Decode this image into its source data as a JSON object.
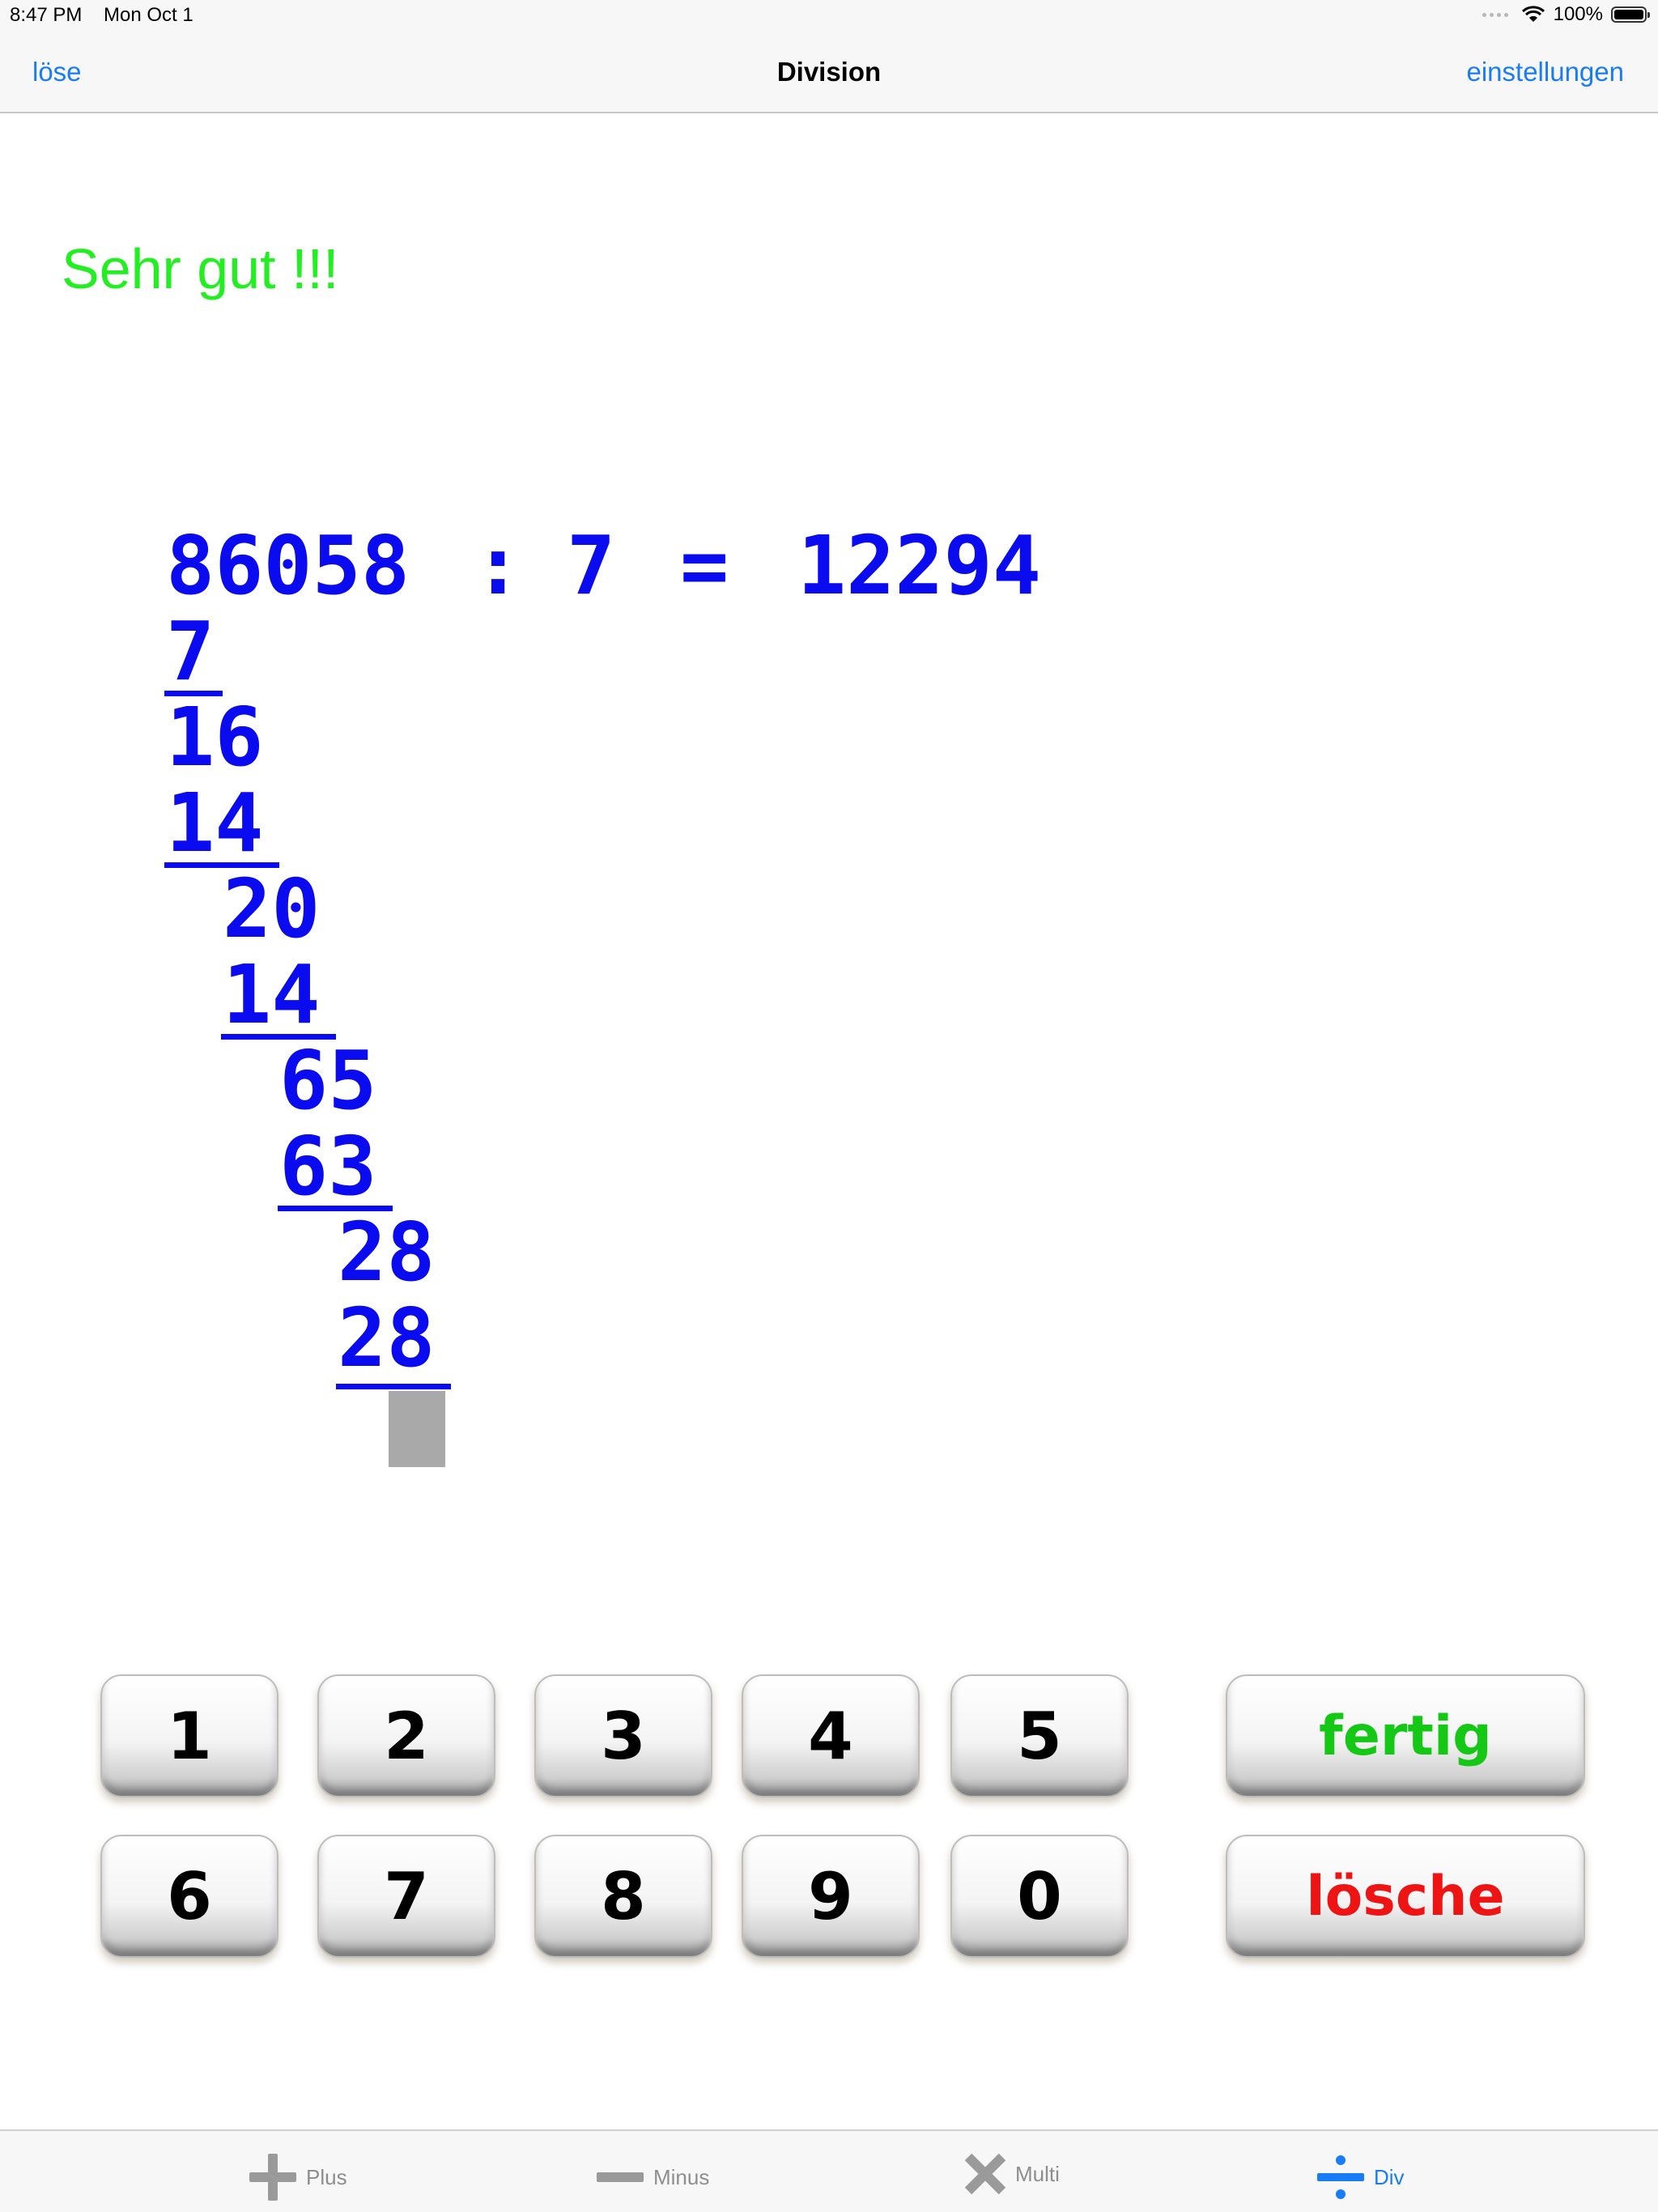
{
  "status_bar": {
    "time": "8:47 PM",
    "date": "Mon Oct 1",
    "battery": "100%"
  },
  "nav": {
    "left_button": "löse",
    "title": "Division",
    "right_button": "einstellungen"
  },
  "feedback": "Sehr gut !!!",
  "problem": {
    "dividend": "86058",
    "operator": ":",
    "divisor": "7",
    "equals": "=",
    "quotient": "12294",
    "steps": [
      "7",
      "16",
      "14",
      "20",
      "14",
      "65",
      "63",
      "28",
      "28"
    ]
  },
  "keypad": {
    "digits": [
      "1",
      "2",
      "3",
      "4",
      "5",
      "6",
      "7",
      "8",
      "9",
      "0"
    ],
    "done_label": "fertig",
    "delete_label": "lösche",
    "done_color": "#16c816",
    "delete_color": "#ee1414"
  },
  "tabs": [
    {
      "label": "Plus",
      "icon": "plus-icon"
    },
    {
      "label": "Minus",
      "icon": "minus-icon"
    },
    {
      "label": "Multi",
      "icon": "multiply-icon"
    },
    {
      "label": "Div",
      "icon": "divide-icon",
      "active": true
    }
  ],
  "colors": {
    "accent": "#1a7cf5",
    "digits": "#0b0bf0",
    "feedback": "#22ee22"
  }
}
